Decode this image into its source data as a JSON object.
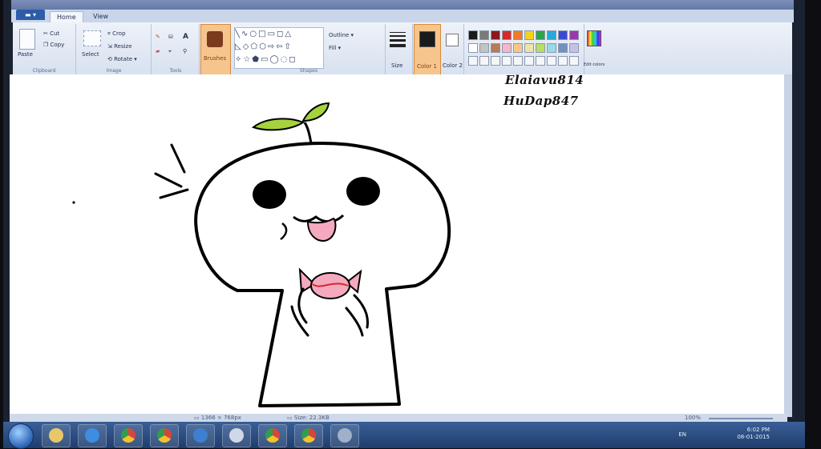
{
  "app": {
    "file_menu_label": "▬ ▾",
    "tabs": [
      "Home",
      "View"
    ],
    "window_controls": [
      "—",
      "▭",
      "✕"
    ]
  },
  "ribbon": {
    "clipboard": {
      "paste": "Paste",
      "cut": "Cut",
      "copy": "Copy",
      "group": "Clipboard"
    },
    "image": {
      "select": "Select",
      "crop": "Crop",
      "resize": "Resize",
      "rotate": "Rotate ▾",
      "group": "Image"
    },
    "tools": {
      "text": "A",
      "group": "Tools"
    },
    "brushes": {
      "label": "Brushes"
    },
    "shapes": {
      "outline": "Outline ▾",
      "fill": "Fill ▾",
      "group": "Shapes"
    },
    "size": {
      "label": "Size"
    },
    "color1": {
      "label": "Color 1",
      "value": "#1a1a1a"
    },
    "color2": {
      "label": "Color 2",
      "value": "#ffffff"
    },
    "edit_colors": {
      "label": "Edit colors"
    },
    "palette_row1": [
      "#1a1a1a",
      "#7a7a7a",
      "#8b1a1a",
      "#d42a2a",
      "#f07a2a",
      "#f2d21e",
      "#2ea34a",
      "#28a8d8",
      "#3a4ad0",
      "#9a3aa8"
    ],
    "palette_row2": [
      "#ffffff",
      "#c3c3c3",
      "#b97a57",
      "#f6b6c8",
      "#f9c88a",
      "#efe4a8",
      "#b5e061",
      "#99d9ea",
      "#7092be",
      "#c8bfe7"
    ]
  },
  "canvas": {
    "signature_line1": "Elaiavu814",
    "signature_line2": "HuDap847"
  },
  "statusbar": {
    "image_size": "▭ 1366 × 768px",
    "file_size": "▭ Size: 22.3KB",
    "zoom": "100%"
  },
  "taskbar": {
    "items": [
      "explorer",
      "ie",
      "chrome",
      "chrome",
      "media",
      "app",
      "chrome",
      "chrome",
      "paint"
    ],
    "language": "EN",
    "time": "6:02 PM",
    "date": "08-01-2015"
  }
}
